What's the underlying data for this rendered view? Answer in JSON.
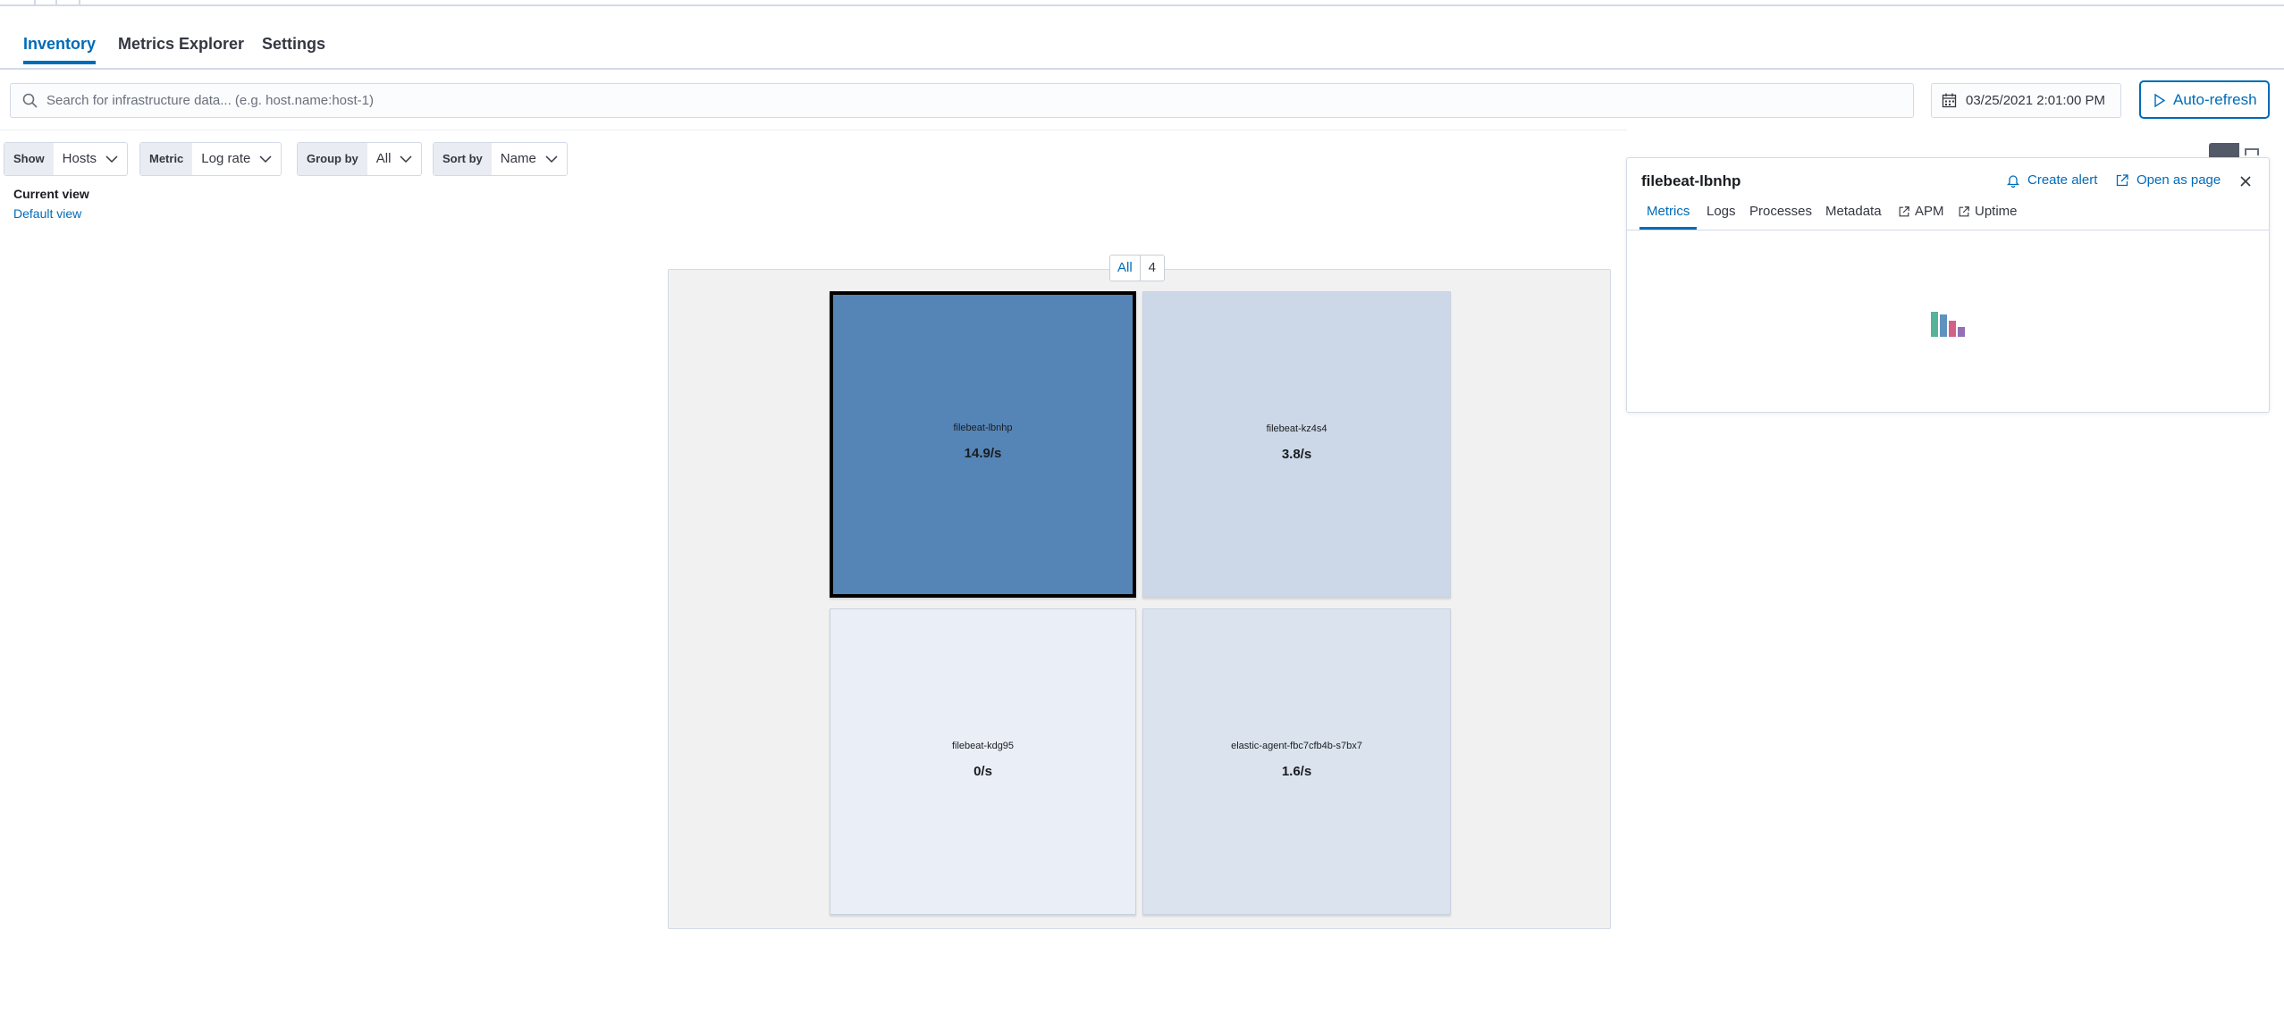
{
  "tabs": [
    {
      "label": "Inventory",
      "active": true
    },
    {
      "label": "Metrics Explorer",
      "active": false
    },
    {
      "label": "Settings",
      "active": false
    }
  ],
  "search": {
    "placeholder": "Search for infrastructure data... (e.g. host.name:host-1)",
    "icon": "search-icon"
  },
  "date_picker": {
    "value": "03/25/2021 2:01:00 PM",
    "icon": "calendar-icon"
  },
  "auto_refresh": {
    "label": "Auto-refresh",
    "icon": "play-icon"
  },
  "filters": {
    "show": {
      "label": "Show",
      "value": "Hosts"
    },
    "metric": {
      "label": "Metric",
      "value": "Log rate"
    },
    "group_by": {
      "label": "Group by",
      "value": "All"
    },
    "sort_by": {
      "label": "Sort by",
      "value": "Name"
    }
  },
  "saved_view": {
    "heading": "Current view",
    "link": "Default view"
  },
  "map": {
    "group": {
      "label": "All",
      "count": "4"
    },
    "nodes": [
      {
        "name": "filebeat-lbnhp",
        "value": "14.9/s",
        "color": "#5585b6",
        "selected": true
      },
      {
        "name": "filebeat-kz4s4",
        "value": "3.8/s",
        "color": "#ccd8e7",
        "selected": false
      },
      {
        "name": "filebeat-kdg95",
        "value": "0/s",
        "color": "#eaeff7",
        "selected": false
      },
      {
        "name": "elastic-agent-fbc7cfb4b-s7bx7",
        "value": "1.6/s",
        "color": "#dbe4ee",
        "selected": false
      }
    ]
  },
  "flyout": {
    "title": "filebeat-lbnhp",
    "create_alert": "Create alert",
    "open_as_page": "Open as page",
    "tabs": [
      "Metrics",
      "Logs",
      "Processes",
      "Metadata",
      "APM",
      "Uptime"
    ],
    "loader_colors": [
      "#54b399",
      "#6092c0",
      "#d36086",
      "#9170b8"
    ]
  },
  "colors": {
    "accent": "#006bb8",
    "text": "#343741",
    "border": "#d3dae6"
  }
}
